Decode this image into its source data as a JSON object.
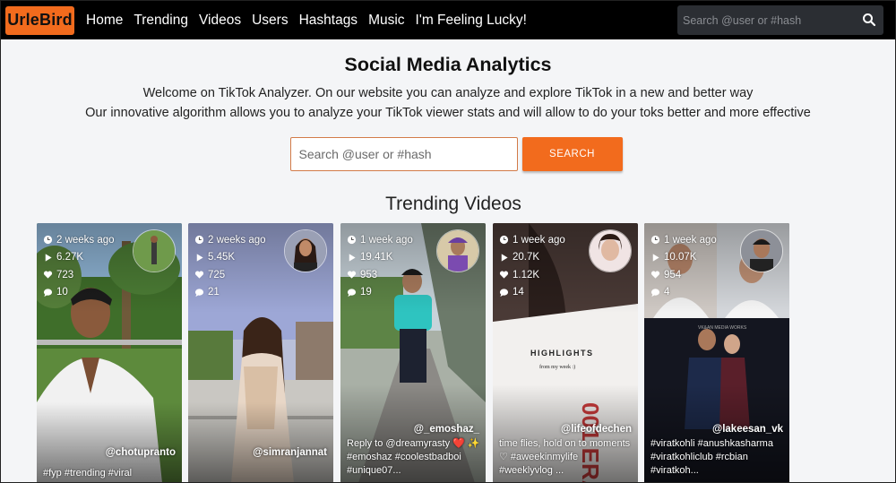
{
  "brand": {
    "logo": "UrleBird",
    "accent": "#f26b1d"
  },
  "nav": {
    "links": [
      "Home",
      "Trending",
      "Videos",
      "Users",
      "Hashtags",
      "Music",
      "I'm Feeling Lucky!"
    ],
    "search_placeholder": "Search @user or #hash",
    "search_icon": "search-icon"
  },
  "hero": {
    "title": "Social Media Analytics",
    "line1": "Welcome on TikTok Analyzer. On our website you can analyze and explore TikTok in a new and better way",
    "line2": "Our innovative algorithm allows you to analyze your TikTok viewer stats and will allow to do your toks better and more effective",
    "search_placeholder": "Search @user or #hash",
    "search_button": "SEARCH"
  },
  "trending": {
    "title": "Trending Videos",
    "cards": [
      {
        "time": "2 weeks ago",
        "plays": "6.27K",
        "likes": "723",
        "comments": "10",
        "handle": "@chotupranto",
        "desc": "#fyp #trending #viral"
      },
      {
        "time": "2 weeks ago",
        "plays": "5.45K",
        "likes": "725",
        "comments": "21",
        "handle": "@simranjannat",
        "desc": ""
      },
      {
        "time": "1 week ago",
        "plays": "19.41K",
        "likes": "953",
        "comments": "19",
        "handle": "@_emoshaz_",
        "desc": "Reply to @dreamyrasty ❤️ ✨ #emoshaz #coolestbadboi #unique07..."
      },
      {
        "time": "1 week ago",
        "plays": "20.7K",
        "likes": "1.12K",
        "comments": "14",
        "handle": "@lifeofdechen",
        "desc": "time flies, hold on to moments ♡ #aweekinmylife #weeklyvlog ..."
      },
      {
        "time": "1 week ago",
        "plays": "10.07K",
        "likes": "954",
        "comments": "4",
        "handle": "@lakeesan_vk",
        "desc": "#viratkohli #anushkasharma #viratkohliclub #rcbian #viratkoh..."
      }
    ]
  }
}
